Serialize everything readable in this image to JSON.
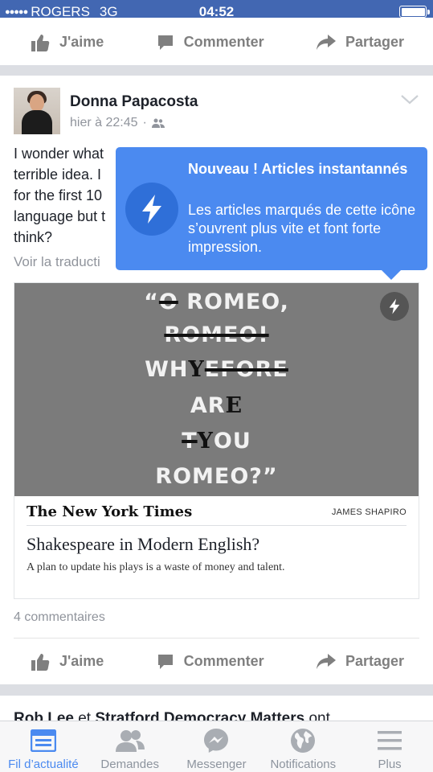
{
  "status_bar": {
    "carrier": "ROGERS",
    "network": "3G",
    "time": "04:52"
  },
  "actions": {
    "like": "J'aime",
    "comment": "Commenter",
    "share": "Partager"
  },
  "post": {
    "author": "Donna Papacosta",
    "time": "hier à 22:45",
    "separator": "·",
    "text_lines": [
      "I wonder what",
      "terrible idea. I",
      "for the first 10",
      "language but t",
      "think?"
    ],
    "translate": "Voir la traducti",
    "comments_count": "4 commentaires"
  },
  "tooltip": {
    "title": "Nouveau ! Articles instantannés",
    "body": "Les articles marqués de cette icône s’ouvrent plus vite et font forte impression."
  },
  "article": {
    "image_lines": [
      "“O ROMEO,",
      "ROMEO!",
      "WHY",
      "ARE",
      "YOU",
      "ROMEO?”"
    ],
    "image_strike": [
      "O",
      "ROMEO!",
      "EFORE",
      "T"
    ],
    "image_ink": [
      "Y",
      "E",
      "Y"
    ],
    "image_plain": [
      "“",
      " ROMEO,",
      "WH",
      "AR",
      "OU"
    ],
    "source": "The New York Times",
    "byline": "JAMES SHAPIRO",
    "title": "Shakespeare in Modern English?",
    "description": "A plan to update his plays is a waste of money and talent."
  },
  "next_post": {
    "name1": "Rob Lee",
    "connector": "et",
    "name2": "Stratford Democracy Matters",
    "suffix": "ont"
  },
  "tabs": [
    {
      "label": "Fil d’actualité",
      "icon": "news-feed-icon",
      "active": true
    },
    {
      "label": "Demandes",
      "icon": "friend-requests-icon",
      "active": false
    },
    {
      "label": "Messenger",
      "icon": "messenger-icon",
      "active": false
    },
    {
      "label": "Notifications",
      "icon": "globe-icon",
      "active": false
    },
    {
      "label": "Plus",
      "icon": "menu-icon",
      "active": false
    }
  ],
  "colors": {
    "brand_blue": "#4267b2",
    "tooltip_blue": "#4b8af0",
    "active_tab": "#4b8af0",
    "muted": "#90949c"
  }
}
